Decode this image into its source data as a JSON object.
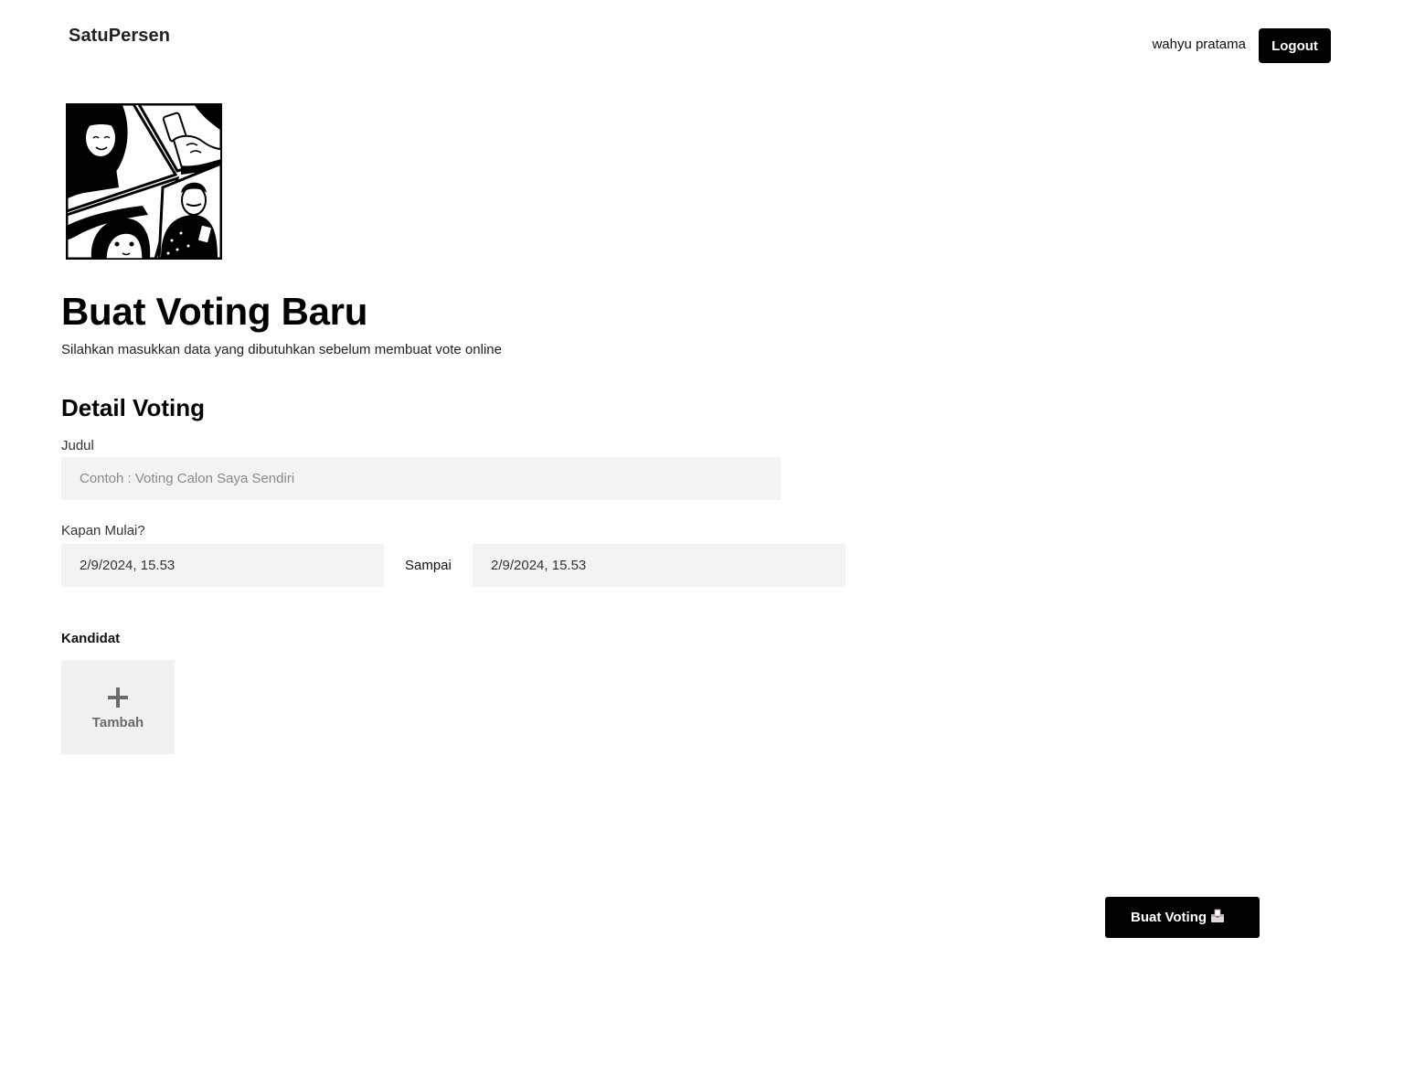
{
  "navbar": {
    "brand": "SatuPersen",
    "user_name": "wahyu pratama",
    "logout_label": "Logout"
  },
  "hero": {
    "illustration_icon": "comic-people-voting-illustration"
  },
  "header": {
    "title": "Buat Voting Baru",
    "subtitle": "Silahkan masukkan data yang dibutuhkan sebelum membuat vote online"
  },
  "form": {
    "section_title": "Detail Voting",
    "title_label": "Judul",
    "title_value": "",
    "title_placeholder": "Contoh : Voting Calon Saya Sendiri",
    "start_label": "Kapan Mulai?",
    "start_value": "2/9/2024, 15.53",
    "end_label": "Sampai",
    "end_value": "2/9/2024, 15.53",
    "candidates_label": "Kandidat",
    "add_candidate_label": "Tambah",
    "add_candidate_icon": "plus-icon"
  },
  "actions": {
    "submit_label": "Buat Voting",
    "submit_icon": "ballot-box-icon"
  },
  "colors": {
    "primary": "#000000",
    "field_bg": "#f3f3f3",
    "tile_bg": "#f1f1f1",
    "muted_text": "#6b6b6b"
  }
}
